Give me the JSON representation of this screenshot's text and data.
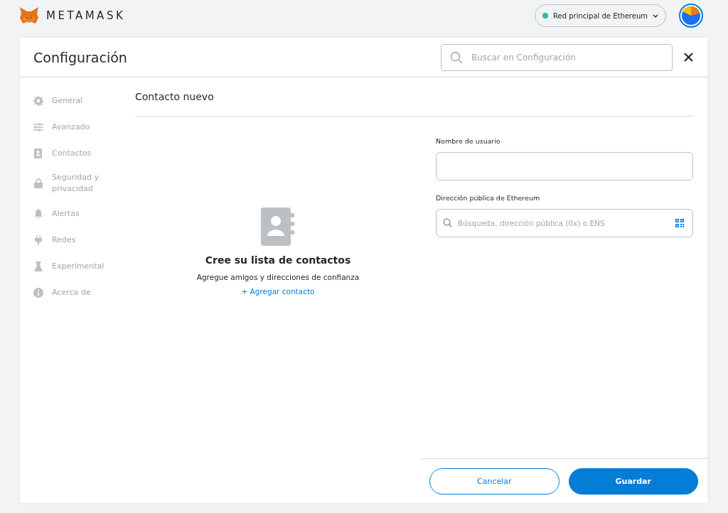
{
  "header": {
    "logo_text": "METAMASK",
    "network": {
      "label": "Red principal de Ethereum",
      "color": "#29b6af"
    }
  },
  "settings": {
    "title": "Configuración",
    "search": {
      "placeholder": "Buscar en Configuración"
    },
    "sidebar": {
      "items": [
        {
          "label": "General",
          "selected": false
        },
        {
          "label": "Avanzado",
          "selected": false
        },
        {
          "label": "Contactos",
          "selected": false
        },
        {
          "label": "Seguridad y privacidad",
          "selected": false
        },
        {
          "label": "Alertas",
          "selected": false
        },
        {
          "label": "Redes",
          "selected": false
        },
        {
          "label": "Experimental",
          "selected": false
        },
        {
          "label": "Acerca de",
          "selected": false
        }
      ]
    },
    "page_title": "Contacto nuevo",
    "empty_state": {
      "title": "Cree su lista de contactos",
      "description": "Agregue amigos y direcciones de confianza",
      "link": "+ Agregar contacto"
    },
    "form": {
      "fields": [
        {
          "label": "Nombre de usuario",
          "kind": "text"
        },
        {
          "label": "Dirección pública de Ethereum",
          "kind": "address",
          "placeholder": "Búsqueda, dirección pública (0x) o ENS"
        }
      ]
    },
    "buttons": [
      {
        "label": "Cancelar",
        "kind": "secondary"
      },
      {
        "label": "Guardar",
        "kind": "primary"
      }
    ]
  }
}
